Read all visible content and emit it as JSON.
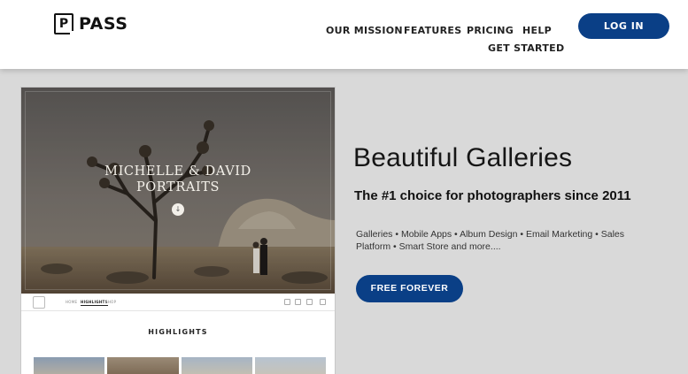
{
  "header": {
    "logo": {
      "letter": "P",
      "text": "PASS"
    },
    "nav": {
      "our_mission": "OUR MISSION",
      "features": "FEATURES",
      "pricing": "PRICING",
      "help": "HELP",
      "get_started": "GET STARTED"
    },
    "login_label": "LOG IN"
  },
  "preview": {
    "hero_title_line1": "MICHELLE & DAVID",
    "hero_title_line2": "PORTRAITS",
    "mini_nav": {
      "home": "HOME",
      "highlights": "HIGHLIGHTS",
      "shop": "SHOP"
    },
    "section_title": "HIGHLIGHTS"
  },
  "content": {
    "headline": "Beautiful Galleries",
    "subhead": "The #1 choice for photographers since 2011",
    "features_text": "Galleries • Mobile Apps • Album Design • Email Marketing • Sales Platform • Smart Store and more....",
    "cta_label": "FREE FOREVER"
  },
  "colors": {
    "brand_blue": "#0a3f86",
    "page_bg": "#d9d9d9"
  }
}
